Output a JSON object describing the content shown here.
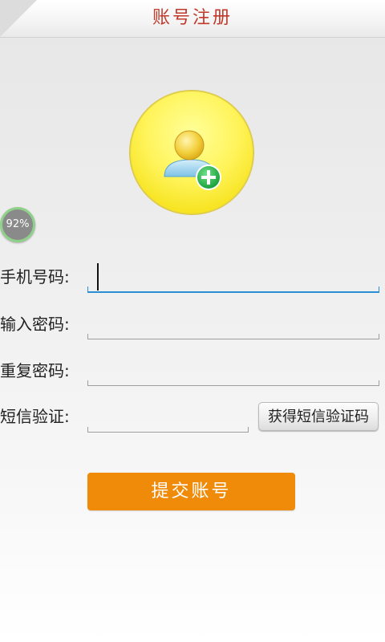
{
  "header": {
    "title": "账号注册"
  },
  "avatar": {
    "icon": "add-user-icon"
  },
  "progress": {
    "percent": 92,
    "label": "92%"
  },
  "form": {
    "phone": {
      "label": "手机号码:",
      "value": "",
      "placeholder": ""
    },
    "password": {
      "label": "输入密码:",
      "value": "",
      "placeholder": ""
    },
    "confirm_password": {
      "label": "重复密码:",
      "value": "",
      "placeholder": ""
    },
    "sms_code": {
      "label": "短信验证:",
      "value": "",
      "placeholder": ""
    },
    "get_sms_button": "获得短信验证码",
    "submit_button": "提交账号"
  },
  "colors": {
    "title": "#c0392b",
    "submit_bg": "#ef8b09",
    "focus_line": "#2b8fd6",
    "avatar_bg": "#fff45c",
    "plus_badge": "#2fb54a"
  }
}
